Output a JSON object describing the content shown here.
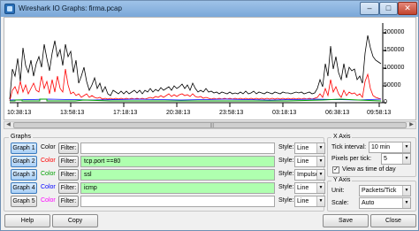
{
  "window": {
    "title": "Wireshark IO Graphs: firma.pcap",
    "minimize": "–",
    "maximize": "□",
    "close": "✕"
  },
  "plot": {
    "x_ticks": [
      "10:38:13",
      "13:58:13",
      "17:18:13",
      "20:38:13",
      "23:58:13",
      "03:18:13",
      "06:38:13",
      "09:58:13"
    ],
    "y_ticks": [
      "200000",
      "150000",
      "100000",
      "50000",
      "0"
    ],
    "series_colors": {
      "black": "#000000",
      "red": "#ff0000",
      "green": "#00a000",
      "blue": "#0000ff"
    }
  },
  "scrollbar": {
    "left_arrow": "◀",
    "right_arrow": "▶",
    "grip": "|||"
  },
  "graphs": {
    "title": "Graphs",
    "color_label": "Color",
    "filter_label": "Filter:",
    "style_label": "Style:",
    "rows": [
      {
        "button": "Graph 1",
        "filter": "",
        "style": "Line",
        "color": "#000000"
      },
      {
        "button": "Graph 2",
        "filter": "tcp.port ==80",
        "style": "Line",
        "color": "#ff0000"
      },
      {
        "button": "Graph 3",
        "filter": "ssl",
        "style": "Impulse",
        "color": "#00a000"
      },
      {
        "button": "Graph 4",
        "filter": "icmp",
        "style": "Line",
        "color": "#0000ff"
      },
      {
        "button": "Graph 5",
        "filter": "",
        "style": "Line",
        "color": "#ff00ff"
      }
    ]
  },
  "x_axis": {
    "title": "X Axis",
    "tick_interval_label": "Tick interval:",
    "tick_interval": "10 min",
    "pixels_per_tick_label": "Pixels per tick:",
    "pixels_per_tick": "5",
    "view_time_label": "View as time of day",
    "view_time_checked": true
  },
  "y_axis": {
    "title": "Y Axis",
    "unit_label": "Unit:",
    "unit": "Packets/Tick",
    "scale_label": "Scale:",
    "scale": "Auto"
  },
  "buttons": {
    "help": "Help",
    "copy": "Copy",
    "save": "Save",
    "close": "Close"
  }
}
